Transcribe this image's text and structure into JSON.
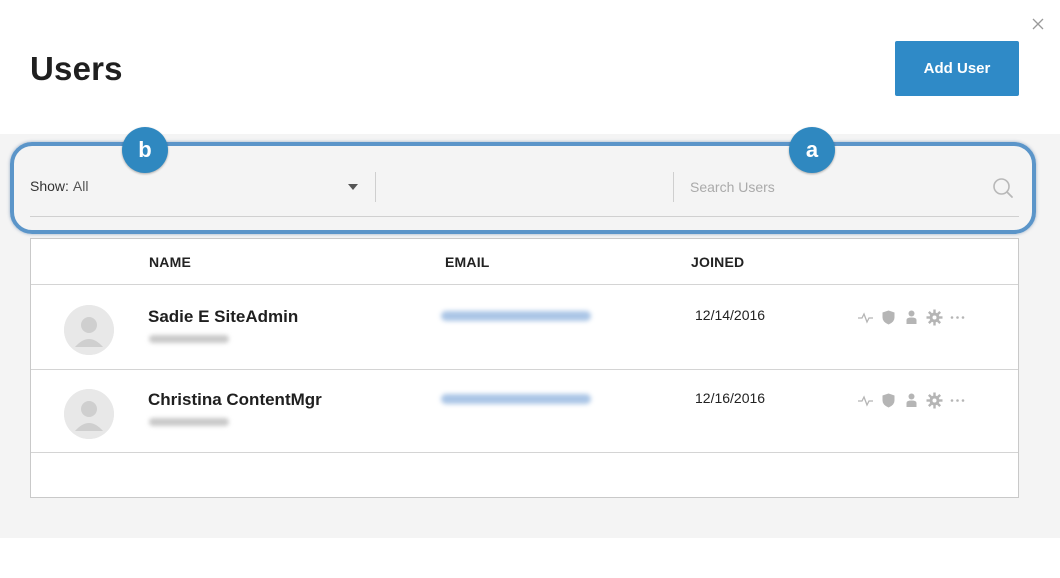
{
  "header": {
    "title": "Users",
    "add_user_label": "Add User"
  },
  "callouts": {
    "b": "b",
    "a": "a"
  },
  "filter": {
    "show_label": "Show:",
    "show_value": "All",
    "search_placeholder": "Search Users"
  },
  "table": {
    "columns": {
      "name": "NAME",
      "email": "EMAIL",
      "joined": "JOINED"
    },
    "rows": [
      {
        "name": "Sadie E SiteAdmin",
        "joined": "12/14/2016"
      },
      {
        "name": "Christina ContentMgr",
        "joined": "12/16/2016"
      }
    ]
  },
  "colors": {
    "accent": "#2f8ac7",
    "callout_border": "#5b95c9",
    "badge": "#2f88c0",
    "panel_bg": "#f4f4f4",
    "icon_gray": "#b5b5b5"
  },
  "icons": {
    "close": "close-icon",
    "search": "search-icon",
    "dropdown": "chevron-down-icon",
    "avatar": "user-avatar-icon",
    "row_actions": [
      "activity-icon",
      "shield-icon",
      "person-icon",
      "gear-icon",
      "more-icon"
    ]
  }
}
